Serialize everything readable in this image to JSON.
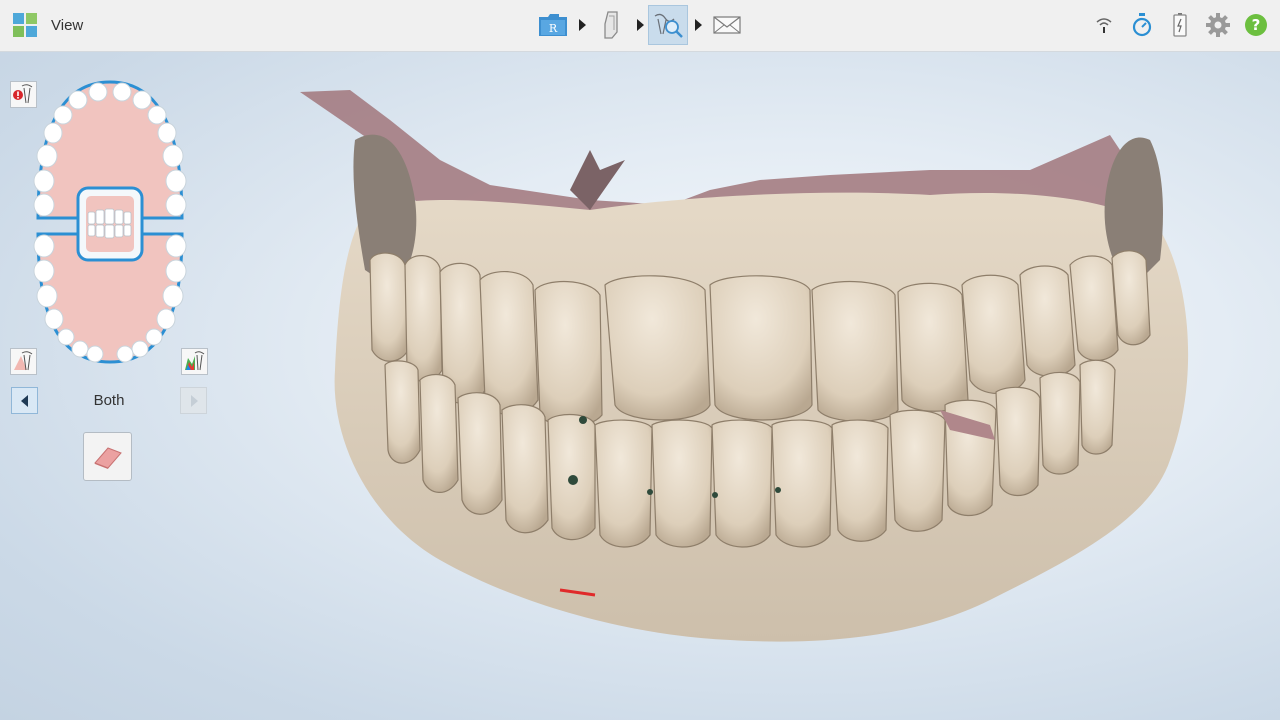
{
  "header": {
    "title": "View",
    "app_icon": "four-squares-logo-icon",
    "workflow_steps": [
      {
        "name": "rx-folder",
        "icon": "rx-folder-icon",
        "active": false
      },
      {
        "name": "scan",
        "icon": "scanner-wand-icon",
        "active": false
      },
      {
        "name": "view",
        "icon": "view-magnify-icon",
        "active": true
      },
      {
        "name": "send",
        "icon": "envelope-icon",
        "active": false
      }
    ],
    "tools": [
      "wifi-icon",
      "timer-icon",
      "battery-icon",
      "gear-icon",
      "help-icon"
    ]
  },
  "left_panel": {
    "jaw_selector_label": "Both",
    "selected_arch": "both",
    "buttons": [
      "missing-data-icon",
      "review-tool-icon",
      "color-map-icon",
      "eraser-icon"
    ]
  },
  "colors": {
    "accent": "#2b8fd3",
    "gum": "#f1c4bf",
    "tooth": "#ffffff",
    "scan_tooth": "#e3d6c3",
    "scan_gum": "#a47c82",
    "topbar": "#f0f0f0"
  }
}
